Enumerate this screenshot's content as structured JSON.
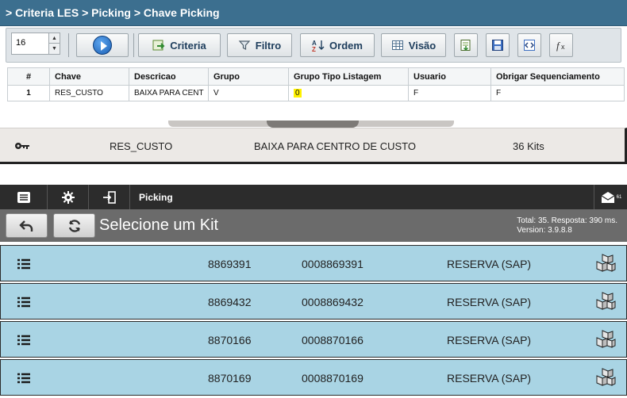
{
  "criteria": {
    "breadcrumb": "> Criteria LES > Picking > Chave Picking",
    "page_size": "16",
    "buttons": {
      "criteria": "Criteria",
      "filtro": "Filtro",
      "ordem": "Ordem",
      "visao": "Visão"
    },
    "columns": [
      "#",
      "Chave",
      "Descricao",
      "Grupo",
      "Grupo Tipo Listagem",
      "Usuario",
      "Obrigar Sequenciamento"
    ],
    "rows": [
      {
        "num": "1",
        "chave": "RES_CUSTO",
        "descricao": "BAIXA PARA CENT",
        "grupo": "V",
        "grupo_tipo": "0",
        "usuario": "F",
        "obrigar": "F"
      }
    ],
    "highlight_color": "#fff200"
  },
  "detail_row": {
    "icon": "key-icon",
    "code": "RES_CUSTO",
    "description": "BAIXA PARA CENTRO DE CUSTO",
    "count": "36 Kits"
  },
  "mobile": {
    "title": "Picking",
    "heading": "Selecione um Kit",
    "meta_line1": "Total: 35. Resposta: 390 ms.",
    "meta_line2": "Version: 3.9.8.8",
    "mail_badge": "61",
    "row_color": "#a9d4e4",
    "kits": [
      {
        "id": "8869391",
        "code": "0008869391",
        "type": "RESERVA (SAP)"
      },
      {
        "id": "8869432",
        "code": "0008869432",
        "type": "RESERVA (SAP)"
      },
      {
        "id": "8870166",
        "code": "0008870166",
        "type": "RESERVA (SAP)"
      },
      {
        "id": "8870169",
        "code": "0008870169",
        "type": "RESERVA (SAP)"
      }
    ]
  }
}
